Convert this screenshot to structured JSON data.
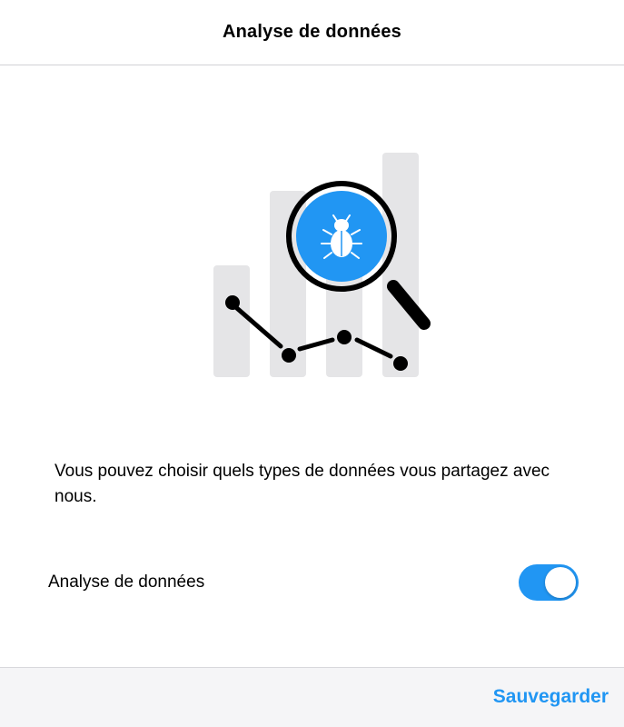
{
  "header": {
    "title": "Analyse de données"
  },
  "illustration": {
    "icon": "data-analysis-bug-magnifier-icon"
  },
  "main": {
    "description": "Vous pouvez choisir quels types de données vous partagez avec nous."
  },
  "setting": {
    "label": "Analyse de données",
    "enabled": true
  },
  "footer": {
    "save_label": "Sauvegarder"
  },
  "colors": {
    "accent": "#2196F3",
    "toggle_on": "#2196F3",
    "bar_gray": "#e5e5e7",
    "footer_bg": "#f5f5f7"
  }
}
